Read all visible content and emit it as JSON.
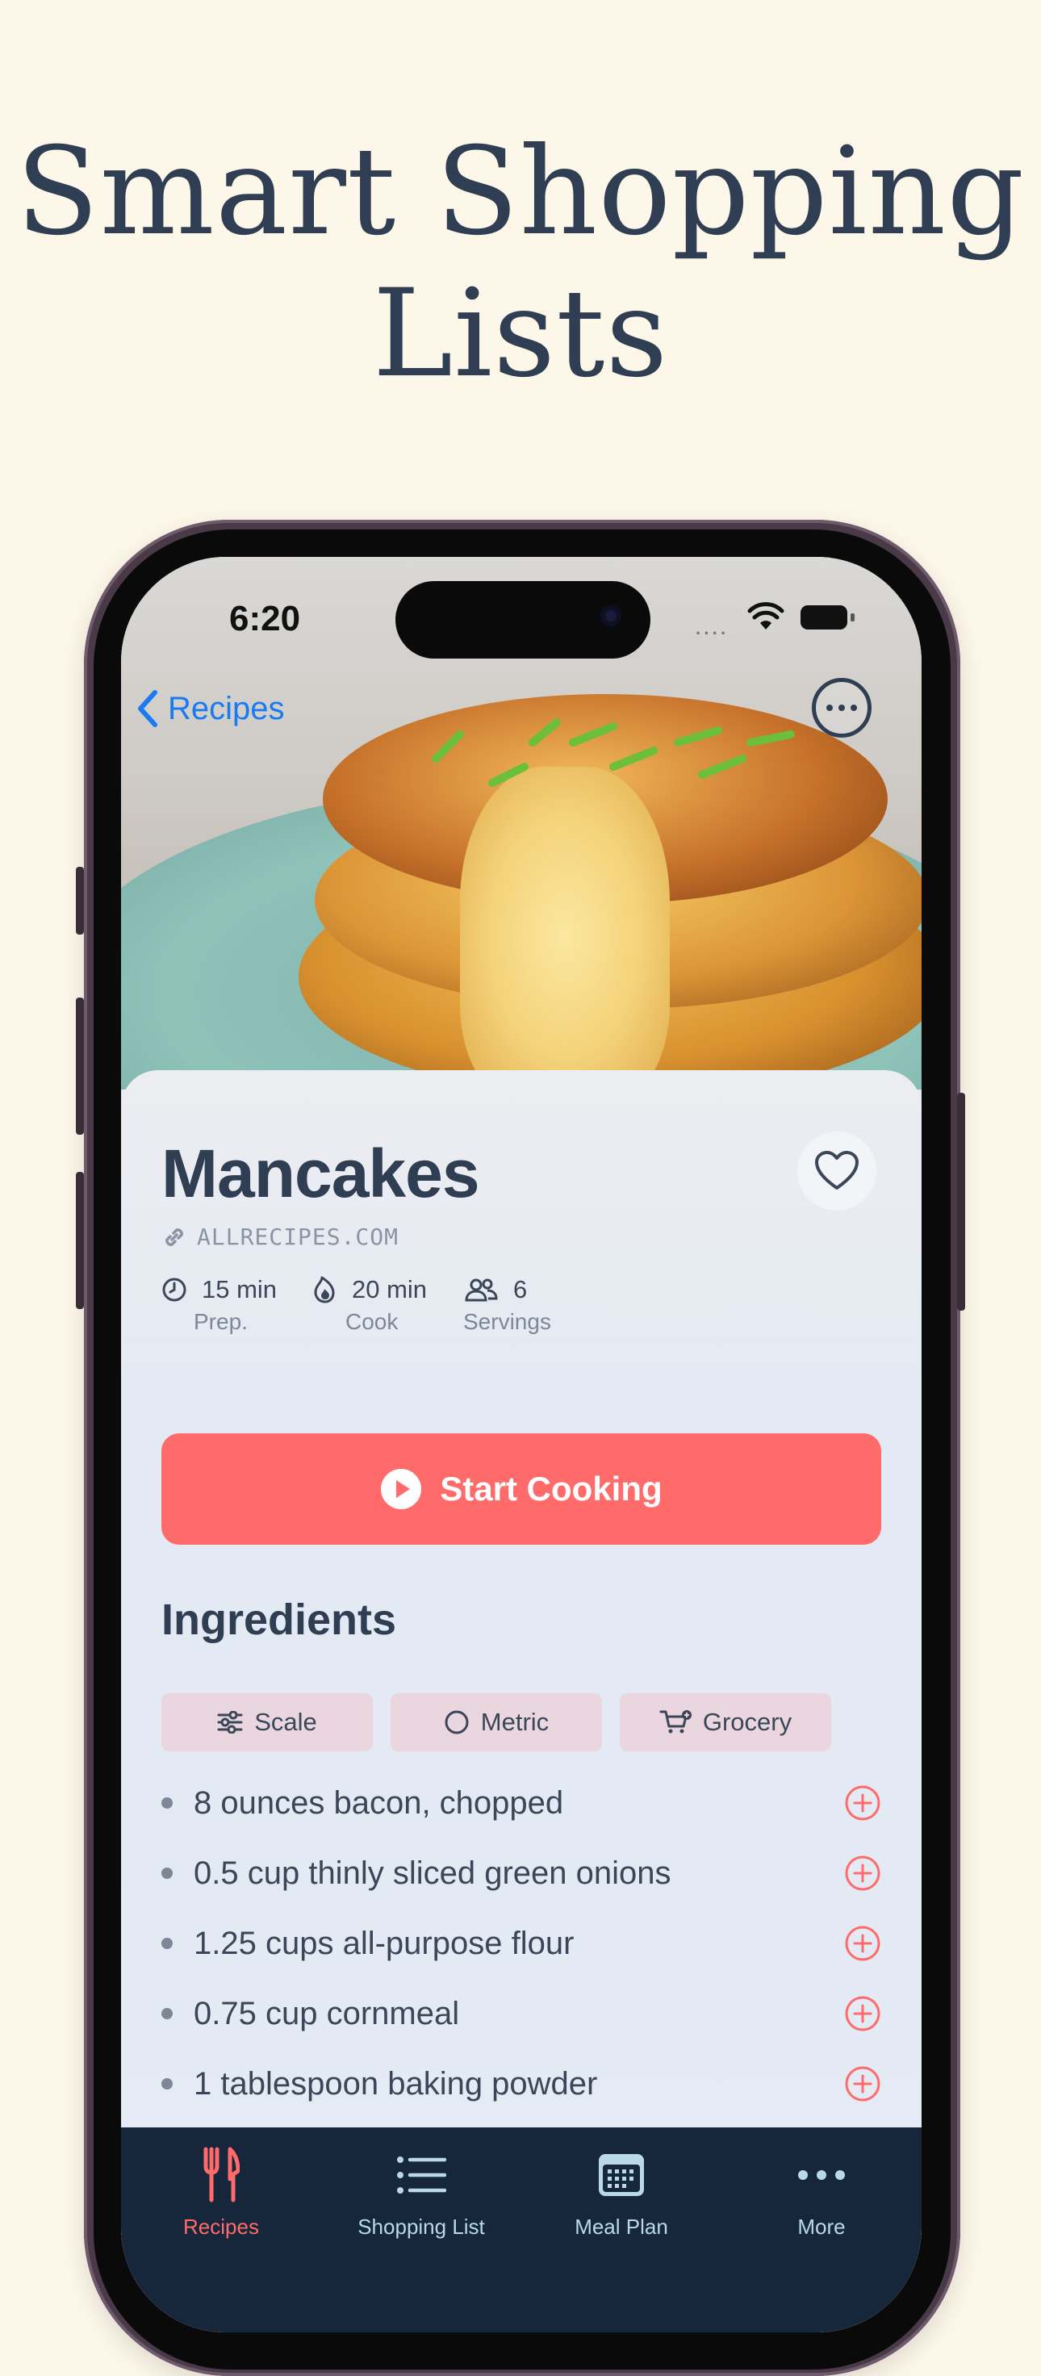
{
  "headline": {
    "line1": "Smart Shopping",
    "line2": "Lists"
  },
  "status_bar": {
    "time": "6:20"
  },
  "nav": {
    "back_label": "Recipes"
  },
  "recipe": {
    "title": "Mancakes",
    "source": "ALLRECIPES.COM",
    "stats": [
      {
        "value": "15 min",
        "label": "Prep.",
        "icon": "clock-icon"
      },
      {
        "value": "20 min",
        "label": "Cook",
        "icon": "flame-icon"
      },
      {
        "value": "6",
        "label": "Servings",
        "icon": "people-icon"
      }
    ]
  },
  "actions": {
    "start_cooking": "Start Cooking"
  },
  "ingredients": {
    "heading": "Ingredients",
    "chips": [
      {
        "label": "Scale",
        "icon": "sliders-icon"
      },
      {
        "label": "Metric",
        "icon": "circle-icon"
      },
      {
        "label": "Grocery",
        "icon": "cart-icon"
      }
    ],
    "items": [
      "8 ounces bacon, chopped",
      "0.5 cup thinly sliced green onions",
      "1.25 cups all-purpose flour",
      "0.75 cup cornmeal",
      "1 tablespoon baking powder"
    ]
  },
  "tabbar": {
    "tabs": [
      {
        "label": "Recipes",
        "icon": "fork-knife-icon",
        "active": true
      },
      {
        "label": "Shopping List",
        "icon": "list-icon",
        "active": false
      },
      {
        "label": "Meal Plan",
        "icon": "calendar-icon",
        "active": false
      },
      {
        "label": "More",
        "icon": "ellipsis-icon",
        "active": false
      }
    ]
  },
  "colors": {
    "background": "#fdf7ea",
    "accent": "#ff6b6b",
    "link": "#1a7af2",
    "heading": "#2f3e52",
    "tabbar": "#16263b"
  }
}
